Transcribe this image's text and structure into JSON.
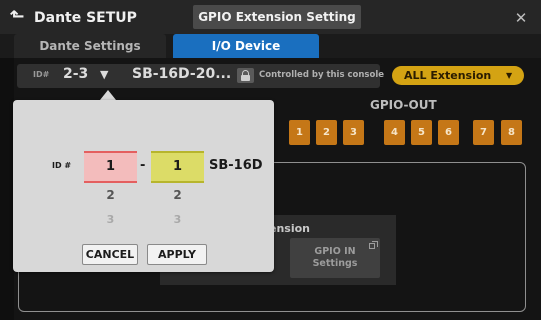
{
  "header": {
    "back_icon": "back-arrow-icon",
    "app_title": "Dante SETUP",
    "screen_title": "GPIO Extension Setting",
    "close_label": "✕"
  },
  "tabs": [
    {
      "label": "Dante Settings",
      "active": false
    },
    {
      "label": "I/O Device",
      "active": true
    }
  ],
  "device": {
    "id_label": "ID#",
    "id_value": "2-3",
    "dropdown_icon": "▼",
    "name": "SB-16D-20...",
    "lock_icon": "lock-icon",
    "controlled_text": "Controlled by this console"
  },
  "extension_select": {
    "value": "ALL Extension",
    "arrow": "▼",
    "color": "#d4a313"
  },
  "gpio_out": {
    "title": "GPIO-OUT",
    "buttons": [
      "1",
      "2",
      "3",
      "4",
      "5",
      "6",
      "7",
      "8"
    ],
    "color": "#c57717"
  },
  "extension_panel": {
    "label": "ension",
    "gpio_in_button": "GPIO IN\nSettings",
    "gpio_in_line1": "GPIO IN",
    "gpio_in_line2": "Settings"
  },
  "popup": {
    "id_label": "ID #",
    "picker1": {
      "selected": "1",
      "next": "2",
      "next2": "3"
    },
    "separator": "-",
    "picker2": {
      "selected": "1",
      "next": "2",
      "next2": "3"
    },
    "model": "SB-16D",
    "cancel_label": "CANCEL",
    "apply_label": "APPLY"
  }
}
